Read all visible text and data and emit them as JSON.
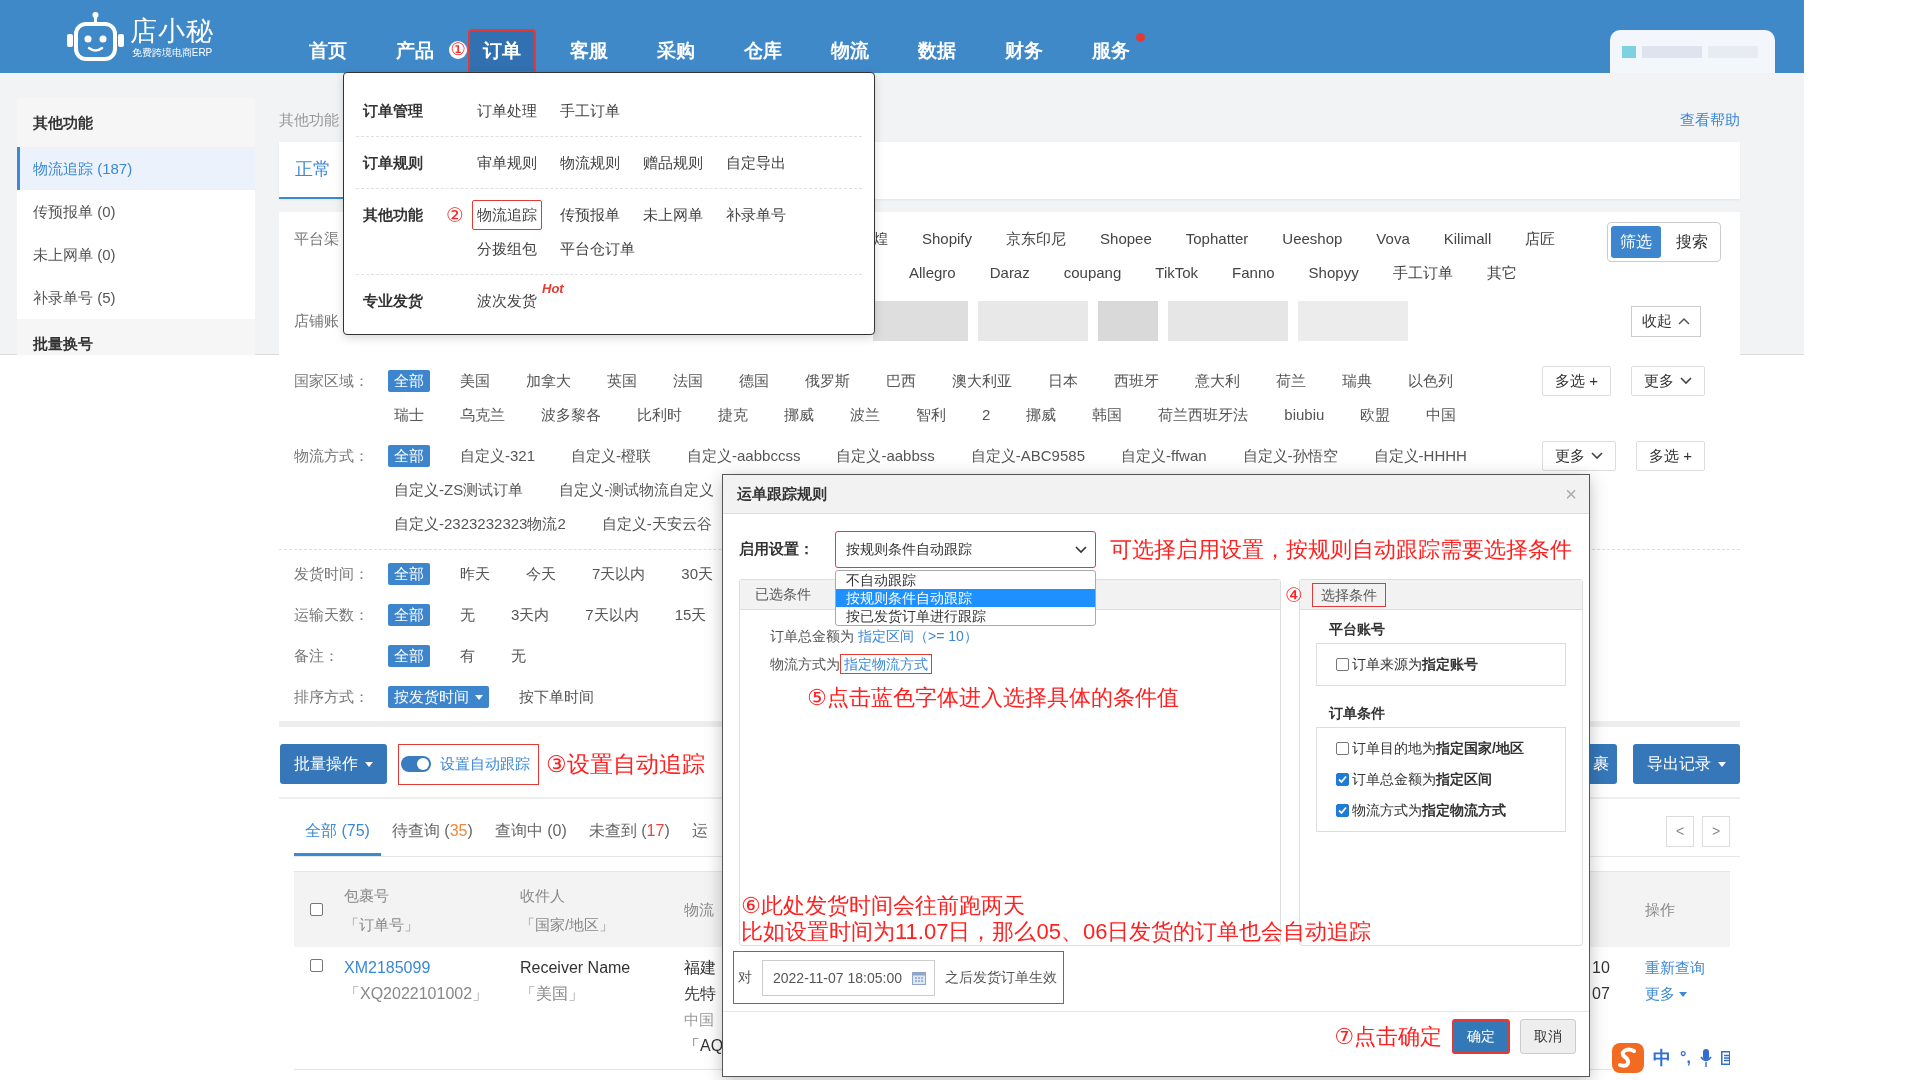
{
  "header": {
    "logo": {
      "name": "店小秘",
      "tagline": "免费跨境电商ERP"
    },
    "nav": [
      {
        "label": "首页",
        "selected": false,
        "highlighted": false,
        "dot": false
      },
      {
        "label": "产品",
        "selected": false,
        "highlighted": false,
        "dot": false,
        "annotation": "①"
      },
      {
        "label": "订单",
        "selected": true,
        "highlighted": true,
        "dot": false
      },
      {
        "label": "客服",
        "selected": false,
        "highlighted": false,
        "dot": false
      },
      {
        "label": "采购",
        "selected": false,
        "highlighted": false,
        "dot": false
      },
      {
        "label": "仓库",
        "selected": false,
        "highlighted": false,
        "dot": false
      },
      {
        "label": "物流",
        "selected": false,
        "highlighted": false,
        "dot": false
      },
      {
        "label": "数据",
        "selected": false,
        "highlighted": false,
        "dot": false
      },
      {
        "label": "财务",
        "selected": false,
        "highlighted": false,
        "dot": false
      },
      {
        "label": "服务",
        "selected": false,
        "highlighted": false,
        "dot": true
      }
    ]
  },
  "nav_menu": {
    "groups": [
      {
        "title": "订单管理",
        "items": [
          {
            "label": "订单处理",
            "highlighted": false
          },
          {
            "label": "手工订单",
            "highlighted": false
          }
        ]
      },
      {
        "title": "订单规则",
        "items": [
          {
            "label": "审单规则",
            "highlighted": false
          },
          {
            "label": "物流规则",
            "highlighted": false
          },
          {
            "label": "赠品规则",
            "highlighted": false
          },
          {
            "label": "自定导出",
            "highlighted": false
          }
        ]
      },
      {
        "title": "其他功能",
        "annotation": "②",
        "items": [
          {
            "label": "物流追踪",
            "highlighted": true
          },
          {
            "label": "传预报单",
            "highlighted": false
          },
          {
            "label": "未上网单",
            "highlighted": false
          },
          {
            "label": "补录单号",
            "highlighted": false
          },
          {
            "label": "分拨组包",
            "highlighted": false
          },
          {
            "label": "平台仓订单",
            "highlighted": false
          }
        ]
      },
      {
        "title": "专业发货",
        "items": [
          {
            "label": "波次发货",
            "highlighted": false,
            "tag": "Hot"
          }
        ]
      }
    ]
  },
  "sidebar": {
    "sections": [
      {
        "title": "其他功能",
        "items": [
          {
            "label": "物流追踪 (187)",
            "selected": true
          },
          {
            "label": "传预报单 (0)",
            "selected": false
          },
          {
            "label": "未上网单 (0)",
            "selected": false
          },
          {
            "label": "补录单号 (5)",
            "selected": false
          }
        ]
      },
      {
        "title": "批量换号"
      }
    ]
  },
  "breadcrumb": "其他功能",
  "help_link": "查看帮助",
  "page_tabs": [
    {
      "label": "正常",
      "selected": true
    }
  ],
  "platform_filter": {
    "label": "平台渠",
    "options": [
      "煌",
      "Shopify",
      "京东印尼",
      "Shopee",
      "Tophatter",
      "Ueeshop",
      "Vova",
      "Kilimall",
      "店匠",
      "Allegro",
      "Daraz",
      "coupang",
      "TikTok",
      "Fanno",
      "Shopyy",
      "手工订单",
      "其它"
    ]
  },
  "view_switch": [
    {
      "label": "筛选",
      "selected": true
    },
    {
      "label": "搜索",
      "selected": false
    }
  ],
  "store_filter": {
    "label": "店铺账",
    "collapse_button": "收起"
  },
  "filters": [
    {
      "label": "国家区域：",
      "divider_after": false,
      "lines": [
        {
          "options": [
            {
              "label": "全部",
              "selected": true
            },
            {
              "label": "美国",
              "selected": false
            },
            {
              "label": "加拿大",
              "selected": false
            },
            {
              "label": "英国",
              "selected": false
            },
            {
              "label": "法国",
              "selected": false
            },
            {
              "label": "德国",
              "selected": false
            },
            {
              "label": "俄罗斯",
              "selected": false
            },
            {
              "label": "巴西",
              "selected": false
            },
            {
              "label": "澳大利亚",
              "selected": false
            },
            {
              "label": "日本",
              "selected": false
            },
            {
              "label": "西班牙",
              "selected": false
            },
            {
              "label": "意大利",
              "selected": false
            },
            {
              "label": "荷兰",
              "selected": false
            },
            {
              "label": "瑞典",
              "selected": false
            },
            {
              "label": "以色列",
              "selected": false
            }
          ]
        },
        {
          "options": [
            {
              "label": "瑞士",
              "selected": false
            },
            {
              "label": "乌克兰",
              "selected": false
            },
            {
              "label": "波多黎各",
              "selected": false
            },
            {
              "label": "比利时",
              "selected": false
            },
            {
              "label": "捷克",
              "selected": false
            },
            {
              "label": "挪威",
              "selected": false
            },
            {
              "label": "波兰",
              "selected": false
            },
            {
              "label": "智利",
              "selected": false
            },
            {
              "label": "2",
              "selected": false
            },
            {
              "label": "挪威",
              "selected": false
            },
            {
              "label": "韩国",
              "selected": false
            },
            {
              "label": "荷兰西班牙法",
              "selected": false
            },
            {
              "label": "biubiu",
              "selected": false
            },
            {
              "label": "欧盟",
              "selected": false
            },
            {
              "label": "中国",
              "selected": false
            }
          ]
        }
      ],
      "buttons": [
        {
          "label": "多选 +",
          "kind": "plain"
        },
        {
          "label": "更多",
          "kind": "expand"
        }
      ]
    },
    {
      "label": "物流方式：",
      "divider_after": true,
      "lines": [
        {
          "options": [
            {
              "label": "全部",
              "selected": true
            },
            {
              "label": "自定义-321",
              "selected": false
            },
            {
              "label": "自定义-橙联",
              "selected": false
            },
            {
              "label": "自定义-aabbccss",
              "selected": false
            },
            {
              "label": "自定义-aabbss",
              "selected": false
            },
            {
              "label": "自定义-ABC9585",
              "selected": false
            },
            {
              "label": "自定义-ffwan",
              "selected": false
            },
            {
              "label": "自定义-孙悟空",
              "selected": false
            },
            {
              "label": "自定义-HHHH",
              "selected": false
            }
          ]
        },
        {
          "options": [
            {
              "label": "自定义-ZS测试订单",
              "selected": false
            },
            {
              "label": "自定义-测试物流自定义",
              "selected": false
            }
          ]
        },
        {
          "options": [
            {
              "label": "自定义-2323232323物流2",
              "selected": false
            },
            {
              "label": "自定义-天安云谷",
              "selected": false
            }
          ]
        }
      ],
      "buttons": [
        {
          "label": "更多",
          "kind": "expand"
        },
        {
          "label": "多选 +",
          "kind": "plain"
        }
      ]
    },
    {
      "label": "发货时间：",
      "divider_after": false,
      "lines": [
        {
          "options": [
            {
              "label": "全部",
              "selected": true
            },
            {
              "label": "昨天",
              "selected": false
            },
            {
              "label": "今天",
              "selected": false
            },
            {
              "label": "7天以内",
              "selected": false
            },
            {
              "label": "30天",
              "selected": false
            }
          ]
        }
      ]
    },
    {
      "label": "运输天数：",
      "divider_after": false,
      "lines": [
        {
          "options": [
            {
              "label": "全部",
              "selected": true
            },
            {
              "label": "无",
              "selected": false
            },
            {
              "label": "3天内",
              "selected": false
            },
            {
              "label": "7天以内",
              "selected": false
            },
            {
              "label": "15天",
              "selected": false
            }
          ]
        }
      ]
    },
    {
      "label": "备注：",
      "divider_after": false,
      "lines": [
        {
          "options": [
            {
              "label": "全部",
              "selected": true
            },
            {
              "label": "有",
              "selected": false
            },
            {
              "label": "无",
              "selected": false
            }
          ]
        }
      ]
    },
    {
      "label": "排序方式：",
      "divider_after": false,
      "lines": [
        {
          "options": [
            {
              "label": "按发货时间",
              "selected": true,
              "kind": "menu"
            },
            {
              "label": "按下单时间",
              "selected": false,
              "kind": "option"
            }
          ]
        }
      ]
    }
  ],
  "toolbar": {
    "batch_button": "批量操作",
    "auto_track": {
      "label": "设置自动跟踪",
      "on": true,
      "highlighted": true
    },
    "annotation": "③设置自动追踪",
    "buttons": [
      {
        "label": "裹",
        "kind": "plain"
      },
      {
        "label": "导出记录",
        "kind": "menu"
      }
    ]
  },
  "status_tabs": [
    {
      "label": "全部 (",
      "count": "75",
      "suffix": ")",
      "color": "#3b88d4",
      "selected": true
    },
    {
      "label": "待查询 (",
      "count": "35",
      "suffix": ")",
      "color": "#f0883a",
      "selected": false
    },
    {
      "label": "查询中 (",
      "count": "0",
      "suffix": ")",
      "color": "#666666",
      "selected": false
    },
    {
      "label": "未查到 (",
      "count": "17",
      "suffix": ")",
      "color": "#e8453c",
      "selected": false
    },
    {
      "label": "运",
      "selected": false
    }
  ],
  "pagination": [
    "<",
    ">"
  ],
  "table": {
    "all_checked": false,
    "columns": [
      {
        "lines": [
          "包裹号",
          "「订单号」"
        ]
      },
      {
        "lines": [
          "收件人",
          "「国家/地区」"
        ]
      },
      {
        "lines": [
          "物流"
        ]
      },
      {
        "lines": [
          "操作"
        ]
      }
    ],
    "rows": [
      {
        "checked": false,
        "package": "XM2185099",
        "order": "「XQ2022101002」",
        "receiver": "Receiver Name",
        "country": "「美国」",
        "logistics": [
          {
            "text": "福建",
            "muted": false
          },
          {
            "text": "先特",
            "muted": false
          },
          {
            "text": "中国",
            "muted": true
          },
          {
            "text": "「AQ",
            "muted": false
          }
        ],
        "column_5": [
          "10",
          "07"
        ],
        "actions": [
          {
            "label": "重新查询",
            "kind": "link"
          },
          {
            "label": "更多",
            "kind": "menu"
          }
        ]
      }
    ]
  },
  "dialog": {
    "title": "运单跟踪规则",
    "close": "×",
    "enable": {
      "label": "启用设置：",
      "value": "按规则条件自动跟踪",
      "highlighted": true,
      "options": [
        {
          "label": "不自动跟踪",
          "selected": false
        },
        {
          "label": "按规则条件自动跟踪",
          "selected": true
        },
        {
          "label": "按已发货订单进行跟踪",
          "selected": false
        }
      ],
      "note": "可选择启用设置，按规则自动跟踪需要选择条件"
    },
    "chosen": {
      "title": "已选条件",
      "conditions": [
        {
          "text": "订单总金额为",
          "link": "指定区间（>= 10）",
          "highlighted": false
        },
        {
          "text": "物流方式为",
          "link": "指定物流方式",
          "highlighted": true
        }
      ],
      "note": "⑤点击蓝色字体进入选择具体的条件值"
    },
    "choices": {
      "marker": "④",
      "title": "选择条件",
      "highlighted": true,
      "groups": [
        {
          "title": "平台账号",
          "options": [
            {
              "text": "订单来源为**指定账号**",
              "checked": false
            }
          ]
        },
        {
          "title": "订单条件",
          "options": [
            {
              "text": "订单目的地为**指定国家/地区**",
              "checked": false
            },
            {
              "text": "订单总金额为**指定区间**",
              "checked": true
            },
            {
              "text": "物流方式为**指定物流方式**",
              "checked": true
            }
          ]
        }
      ]
    },
    "notes": [
      "⑥此处发货时间会往前跑两天",
      "比如设置时间为11.07日，那么05、06日发货的订单也会自动追踪"
    ],
    "start": {
      "prefix": "对",
      "value": "2022-11-07 18:05:00",
      "suffix": "之后发货订单生效",
      "highlighted": true
    },
    "footer_note": "⑦点击确定",
    "buttons": [
      {
        "label": "确定",
        "kind": "primary",
        "highlighted": true
      },
      {
        "label": "取消",
        "kind": "default",
        "highlighted": false
      }
    ]
  },
  "ime_toolbar": {
    "mode": "中",
    "punctuation": "°,"
  }
}
